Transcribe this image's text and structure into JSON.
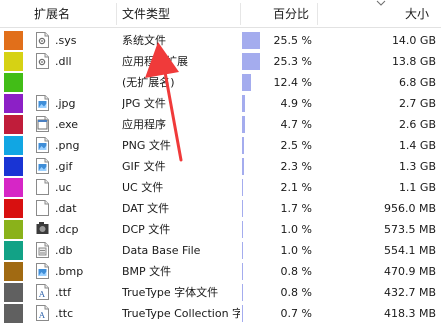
{
  "columns": {
    "ext": "扩展名",
    "type": "文件类型",
    "percent": "百分比",
    "size": "大小"
  },
  "sort_icon": "sort-descending-icon",
  "accent": "#a4acee",
  "rows": [
    {
      "color": "#e16f1a",
      "icon": "system-file-icon",
      "ext": ".sys",
      "type": "系统文件",
      "percent_value": 25.5,
      "percent": "25.5 %",
      "size": "14.0 GB"
    },
    {
      "color": "#d6d214",
      "icon": "system-file-icon",
      "ext": ".dll",
      "type": "应用程序扩展",
      "percent_value": 25.3,
      "percent": "25.3 %",
      "size": "13.8 GB"
    },
    {
      "color": "#42bd17",
      "icon": "",
      "ext": "",
      "type": "(无扩展名)",
      "percent_value": 12.4,
      "percent": "12.4 %",
      "size": "6.8 GB"
    },
    {
      "color": "#8c20c6",
      "icon": "image-file-icon",
      "ext": ".jpg",
      "type": "JPG 文件",
      "percent_value": 4.9,
      "percent": "4.9 %",
      "size": "2.7 GB"
    },
    {
      "color": "#c01d3a",
      "icon": "app-icon",
      "ext": ".exe",
      "type": "应用程序",
      "percent_value": 4.7,
      "percent": "4.7 %",
      "size": "2.6 GB"
    },
    {
      "color": "#11a6e3",
      "icon": "image-file-icon",
      "ext": ".png",
      "type": "PNG 文件",
      "percent_value": 2.5,
      "percent": "2.5 %",
      "size": "1.4 GB"
    },
    {
      "color": "#1934d4",
      "icon": "image-file-icon",
      "ext": ".gif",
      "type": "GIF 文件",
      "percent_value": 2.3,
      "percent": "2.3 %",
      "size": "1.3 GB"
    },
    {
      "color": "#d626c6",
      "icon": "file-icon",
      "ext": ".uc",
      "type": "UC 文件",
      "percent_value": 2.1,
      "percent": "2.1 %",
      "size": "1.1 GB"
    },
    {
      "color": "#d81010",
      "icon": "file-icon",
      "ext": ".dat",
      "type": "DAT 文件",
      "percent_value": 1.7,
      "percent": "1.7 %",
      "size": "956.0 MB"
    },
    {
      "color": "#8ab21a",
      "icon": "dcp-file-icon",
      "ext": ".dcp",
      "type": "DCP 文件",
      "percent_value": 1.0,
      "percent": "1.0 %",
      "size": "573.5 MB"
    },
    {
      "color": "#12a286",
      "icon": "database-file-icon",
      "ext": ".db",
      "type": "Data Base File",
      "percent_value": 1.0,
      "percent": "1.0 %",
      "size": "554.1 MB"
    },
    {
      "color": "#a16a12",
      "icon": "image-file-icon",
      "ext": ".bmp",
      "type": "BMP 文件",
      "percent_value": 0.8,
      "percent": "0.8 %",
      "size": "470.9 MB"
    },
    {
      "color": "#606060",
      "icon": "font-file-icon",
      "ext": ".ttf",
      "type": "TrueType 字体文件",
      "percent_value": 0.8,
      "percent": "0.8 %",
      "size": "432.7 MB"
    },
    {
      "color": "#606060",
      "icon": "font-file-icon",
      "ext": ".ttc",
      "type": "TrueType Collection 字体",
      "percent_value": 0.7,
      "percent": "0.7 %",
      "size": "418.3 MB"
    }
  ]
}
